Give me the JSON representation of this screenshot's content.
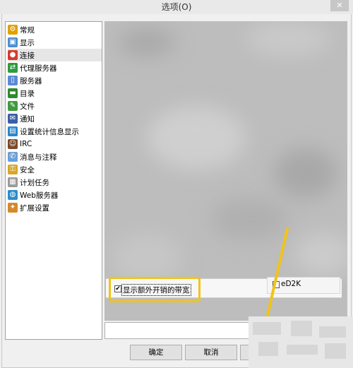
{
  "window": {
    "title": "选项(O)",
    "close_label": "✕"
  },
  "sidebar": {
    "items": [
      {
        "label": "常规",
        "icon": "general-icon",
        "color": "#e1a100",
        "glyph": "⚙"
      },
      {
        "label": "显示",
        "icon": "display-icon",
        "color": "#4a8ed8",
        "glyph": "▣"
      },
      {
        "label": "连接",
        "icon": "connection-icon",
        "color": "#d43a2f",
        "glyph": "●"
      },
      {
        "label": "代理服务器",
        "icon": "proxy-icon",
        "color": "#2f9a3e",
        "glyph": "⇄"
      },
      {
        "label": "服务器",
        "icon": "server-icon",
        "color": "#5b8bd3",
        "glyph": "▯"
      },
      {
        "label": "目录",
        "icon": "directory-icon",
        "color": "#2e8a2e",
        "glyph": "▬"
      },
      {
        "label": "文件",
        "icon": "file-icon",
        "color": "#3e9b3e",
        "glyph": "✎"
      },
      {
        "label": "通知",
        "icon": "notification-icon",
        "color": "#3a5fa8",
        "glyph": "✉"
      },
      {
        "label": "设置统计信息显示",
        "icon": "statistics-icon",
        "color": "#2a86c9",
        "glyph": "▤"
      },
      {
        "label": "IRC",
        "icon": "irc-icon",
        "color": "#7a4a2a",
        "glyph": "☺"
      },
      {
        "label": "消息与注释",
        "icon": "message-icon",
        "color": "#6aa0d8",
        "glyph": "✆"
      },
      {
        "label": "安全",
        "icon": "security-icon",
        "color": "#d8a72a",
        "glyph": "⚿"
      },
      {
        "label": "计划任务",
        "icon": "schedule-icon",
        "color": "#9a9a9a",
        "glyph": "▦"
      },
      {
        "label": "Web服务器",
        "icon": "web-server-icon",
        "color": "#2a8ccc",
        "glyph": "◍"
      },
      {
        "label": "扩展设置",
        "icon": "extended-settings-icon",
        "color": "#d6892a",
        "glyph": "✦"
      }
    ],
    "selected_index": 2
  },
  "options": {
    "show_overhead_bandwidth": {
      "label": "显示额外开销的带宽",
      "checked": true
    },
    "ed2k": {
      "label": "eD2K",
      "checked": false
    }
  },
  "buttons": {
    "ok": "确定",
    "cancel": "取消"
  },
  "colors": {
    "highlight": "#f0c419",
    "selected_item_bg": "#e6e6e6"
  }
}
